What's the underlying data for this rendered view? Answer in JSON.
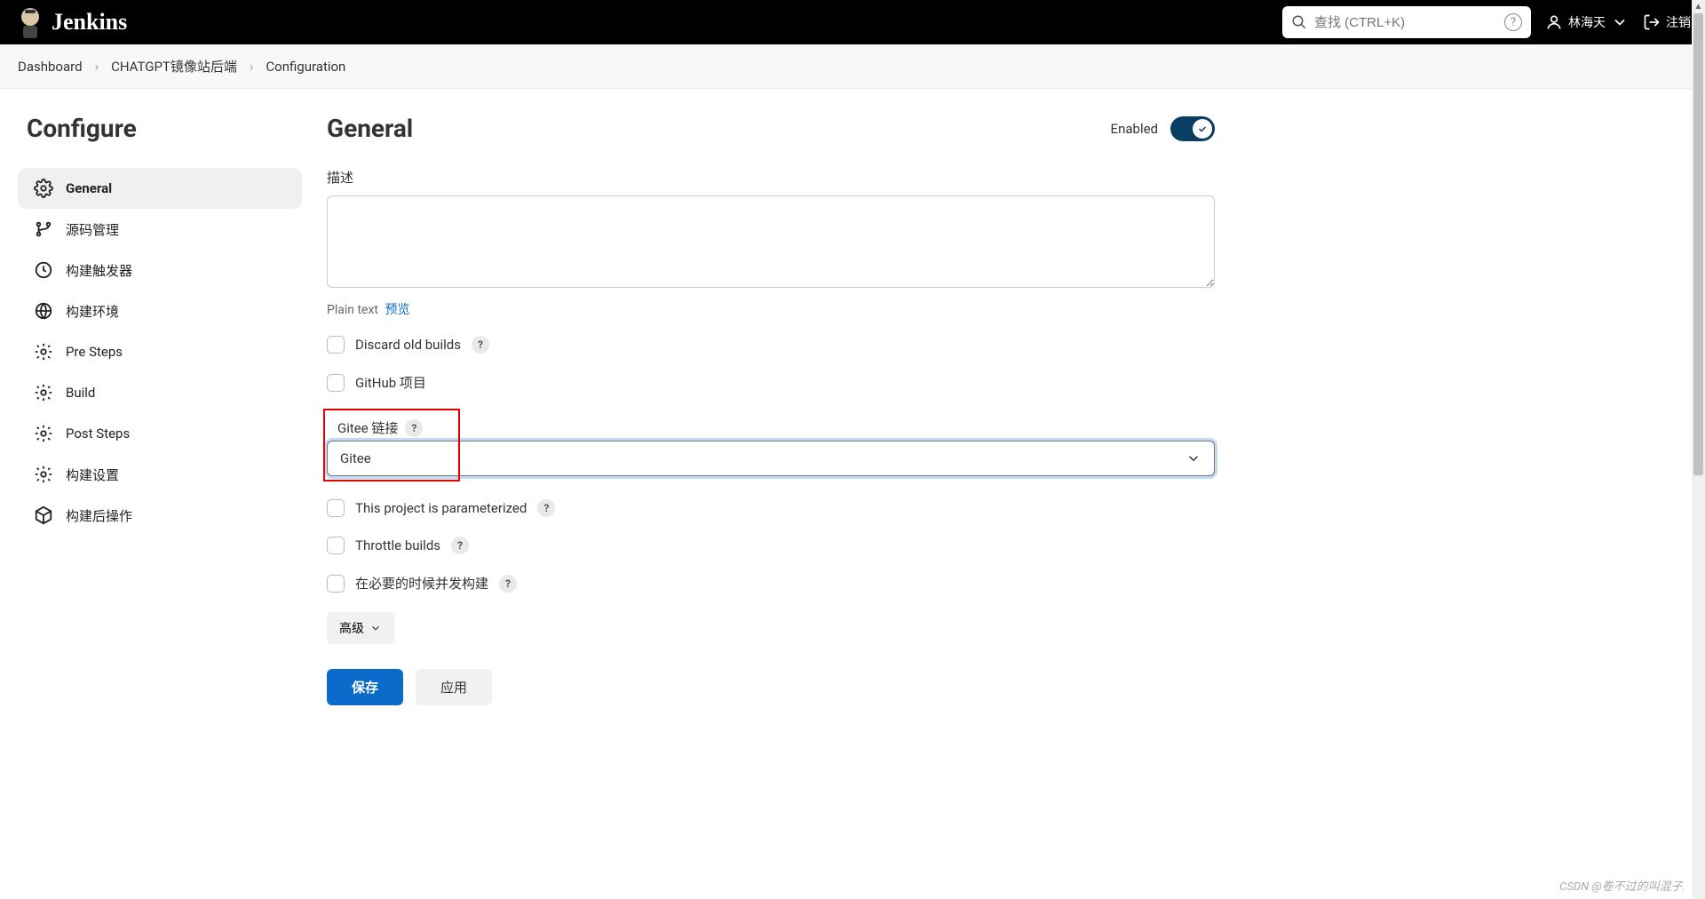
{
  "header": {
    "brand": "Jenkins",
    "search_placeholder": "查找 (CTRL+K)",
    "user_name": "林海天",
    "logout": "注销"
  },
  "breadcrumb": {
    "items": [
      "Dashboard",
      "CHATGPT镜像站后端",
      "Configuration"
    ]
  },
  "sidebar": {
    "title": "Configure",
    "items": [
      {
        "label": "General"
      },
      {
        "label": "源码管理"
      },
      {
        "label": "构建触发器"
      },
      {
        "label": "构建环境"
      },
      {
        "label": "Pre Steps"
      },
      {
        "label": "Build"
      },
      {
        "label": "Post Steps"
      },
      {
        "label": "构建设置"
      },
      {
        "label": "构建后操作"
      }
    ]
  },
  "main": {
    "title": "General",
    "enabled_label": "Enabled",
    "description": {
      "label": "描述",
      "value": "",
      "footer_text": "Plain text",
      "preview": "预览"
    },
    "options": {
      "discard_old_builds": "Discard old builds",
      "github_project": "GitHub 项目",
      "gitee_link_label": "Gitee 链接",
      "gitee_selected": "Gitee",
      "parameterized": "This project is parameterized",
      "throttle_builds": "Throttle builds",
      "concurrent_builds": "在必要的时候并发构建"
    },
    "advanced_label": "高级",
    "save_label": "保存",
    "apply_label": "应用"
  },
  "watermark": "CSDN @卷不过的叫混子."
}
